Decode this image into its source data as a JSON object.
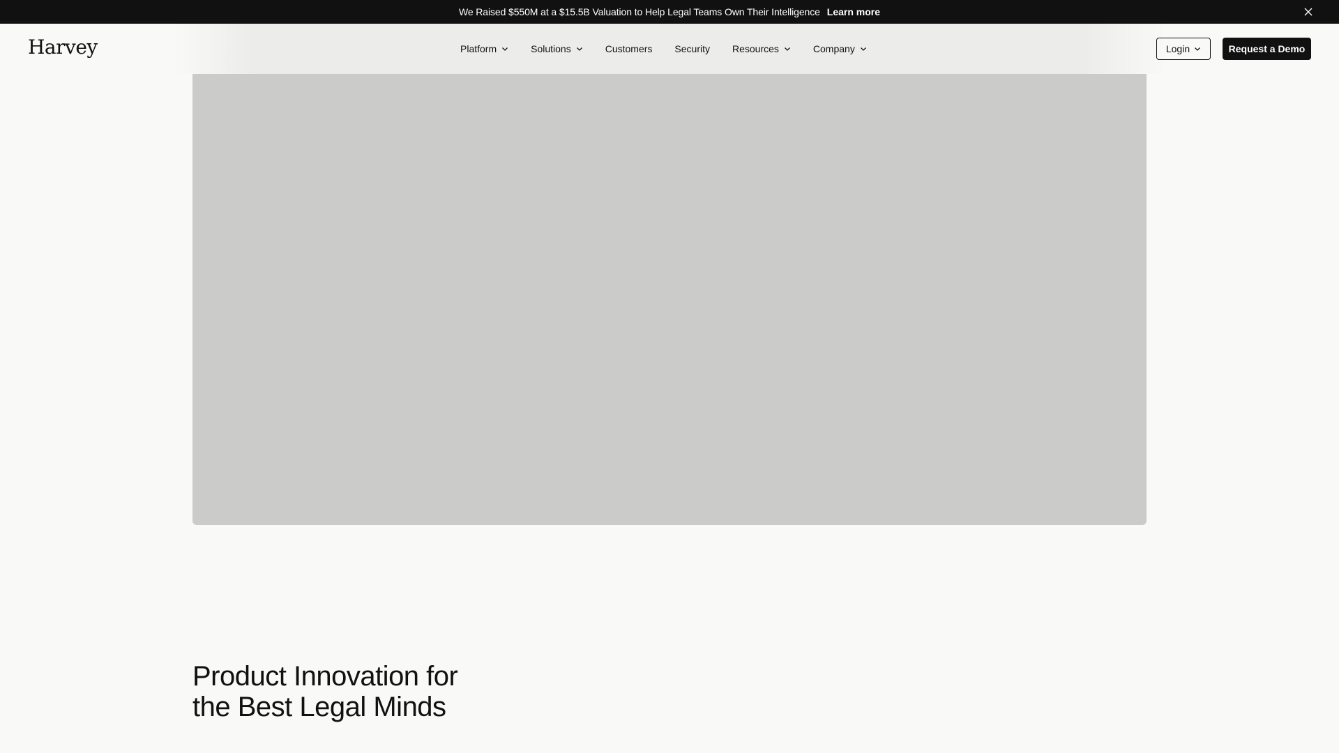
{
  "announcement": {
    "message": "We Raised $550M at a $15.5B Valuation to Help Legal Teams Own Their Intelligence",
    "link_label": "Learn more",
    "close_icon": "close-icon"
  },
  "header": {
    "logo_text": "Harvey",
    "nav": [
      {
        "label": "Platform",
        "has_dropdown": true
      },
      {
        "label": "Solutions",
        "has_dropdown": true
      },
      {
        "label": "Customers",
        "has_dropdown": false
      },
      {
        "label": "Security",
        "has_dropdown": false
      },
      {
        "label": "Resources",
        "has_dropdown": true
      },
      {
        "label": "Company",
        "has_dropdown": true
      }
    ],
    "login_label": "Login",
    "demo_label": "Request a Demo"
  },
  "hero": {
    "headline_line1": "Product Innovation for",
    "headline_line2": "the Best Legal Minds"
  },
  "colors": {
    "topbar": "#111111",
    "background": "#f9f9f7",
    "media_placeholder": "#cbcbc9",
    "button_dark": "#111111"
  }
}
